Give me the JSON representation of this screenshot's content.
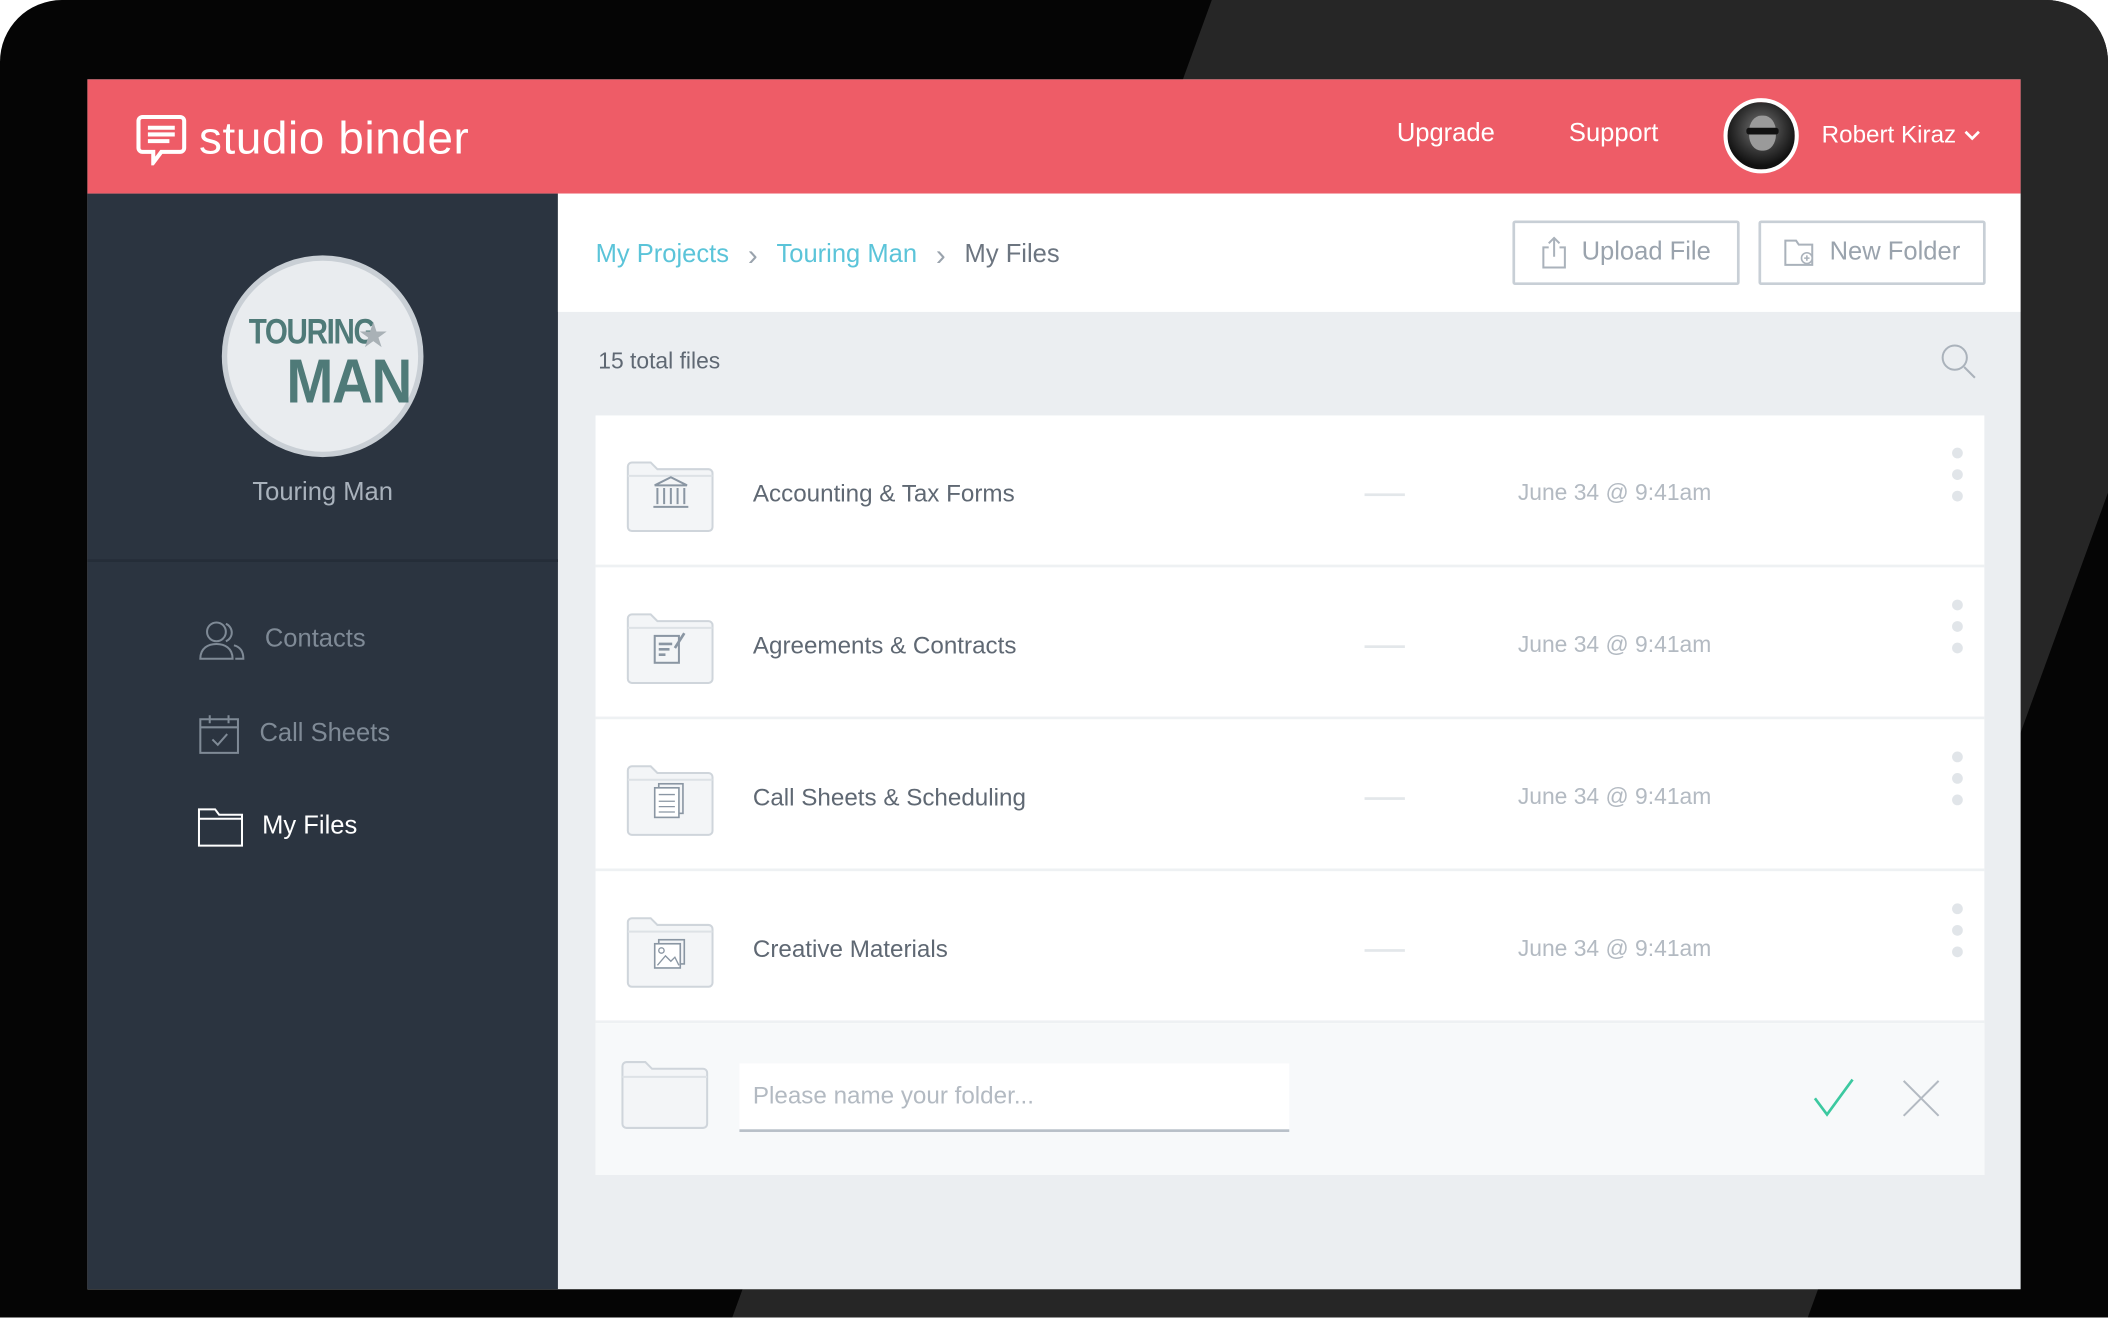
{
  "header": {
    "logo_text": "studio binder",
    "nav": [
      "Upgrade",
      "Support"
    ],
    "user_name": "Robert Kiraz",
    "brand_color": "#ee5c67"
  },
  "sidebar": {
    "project_logo_text": [
      "TOURING",
      "MAN"
    ],
    "project_name": "Touring Man",
    "items": [
      {
        "label": "Contacts",
        "icon": "contacts-icon"
      },
      {
        "label": "Call Sheets",
        "icon": "calendar-check-icon"
      },
      {
        "label": "My Files",
        "icon": "folder-icon",
        "active": true
      }
    ]
  },
  "breadcrumb": [
    "My Projects",
    "Touring Man",
    "My Files"
  ],
  "toolbar": {
    "upload_label": "Upload File",
    "new_folder_label": "New Folder"
  },
  "files": {
    "total": "15 total files",
    "rows": [
      {
        "name": "Accounting & Tax Forms",
        "size": "—",
        "date": "June 34 @ 9:41am",
        "icon": "bank-icon"
      },
      {
        "name": "Agreements & Contracts",
        "size": "—",
        "date": "June 34 @ 9:41am",
        "icon": "contract-sign-icon"
      },
      {
        "name": "Call Sheets & Scheduling",
        "size": "—",
        "date": "June 34 @ 9:41am",
        "icon": "document-stack-icon"
      },
      {
        "name": "Creative Materials",
        "size": "—",
        "date": "June 34 @ 9:41am",
        "icon": "image-icon"
      }
    ],
    "new_folder_placeholder": "Please name your folder...",
    "confirm_color": "#3cc9a0"
  }
}
